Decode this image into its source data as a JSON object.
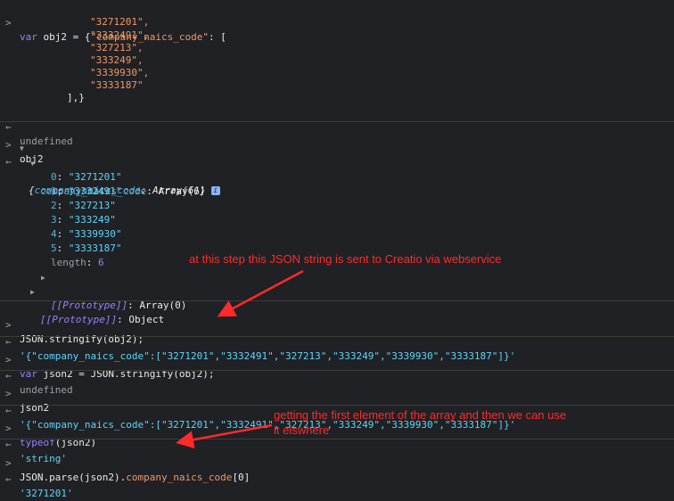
{
  "console": {
    "prompt_glyph": ">",
    "result_glyph": "←",
    "entry1": {
      "kw": "var",
      "name": "obj2",
      "eq_open": " = {",
      "key": "\"company_naics_code\"",
      "colon_open": ": [",
      "items": [
        "\"3271201\",",
        "\"3332491\",",
        "\"327213\",",
        "\"333249\",",
        "\"3339930\",",
        "\"3333187\""
      ],
      "close": "],}",
      "result": "undefined"
    },
    "entry2": {
      "input": "obj2",
      "summary_open": "{",
      "summary_key": "company_naics_code",
      "summary_val": ": Array(6)}",
      "info_glyph": "i",
      "prop_key": "company_naics_code",
      "prop_val": ": Array(6)",
      "array_items": [
        {
          "idx": "0",
          "val": "\"3271201\""
        },
        {
          "idx": "1",
          "val": "\"3332491\""
        },
        {
          "idx": "2",
          "val": "\"327213\""
        },
        {
          "idx": "3",
          "val": "\"333249\""
        },
        {
          "idx": "4",
          "val": "\"3339930\""
        },
        {
          "idx": "5",
          "val": "\"3333187\""
        }
      ],
      "length_key": "length",
      "length_val": "6",
      "proto_key": "[[Prototype]]",
      "proto_array_val": "Array(0)",
      "proto_object_val": "Object"
    },
    "entry3": {
      "obj": "JSON",
      "method": ".stringify(obj2);",
      "result": "'{\"company_naics_code\":[\"3271201\",\"3332491\",\"327213\",\"333249\",\"3339930\",\"3333187\"]}'"
    },
    "entry4": {
      "kw": "var",
      "rest": " json2 = JSON.stringify(obj2);",
      "result": "undefined"
    },
    "entry5": {
      "input": "json2",
      "result": "'{\"company_naics_code\":[\"3271201\",\"3332491\",\"327213\",\"333249\",\"3339930\",\"3333187\"]}'"
    },
    "entry6": {
      "kw": "typeof",
      "rest": "(json2)",
      "result": "'string'"
    },
    "entry7": {
      "obj": "JSON",
      "method": ".parse(json2).",
      "prop": "company_naics_code",
      "index": "[0]",
      "result": "'3271201'"
    }
  },
  "annotations": {
    "note1": "at this step this JSON string is sent to Creatio via webservice",
    "note2_line1": "getting the first element of the array and then we can use",
    "note2_line2": "it elswhere",
    "color": "#ff2a2a"
  }
}
